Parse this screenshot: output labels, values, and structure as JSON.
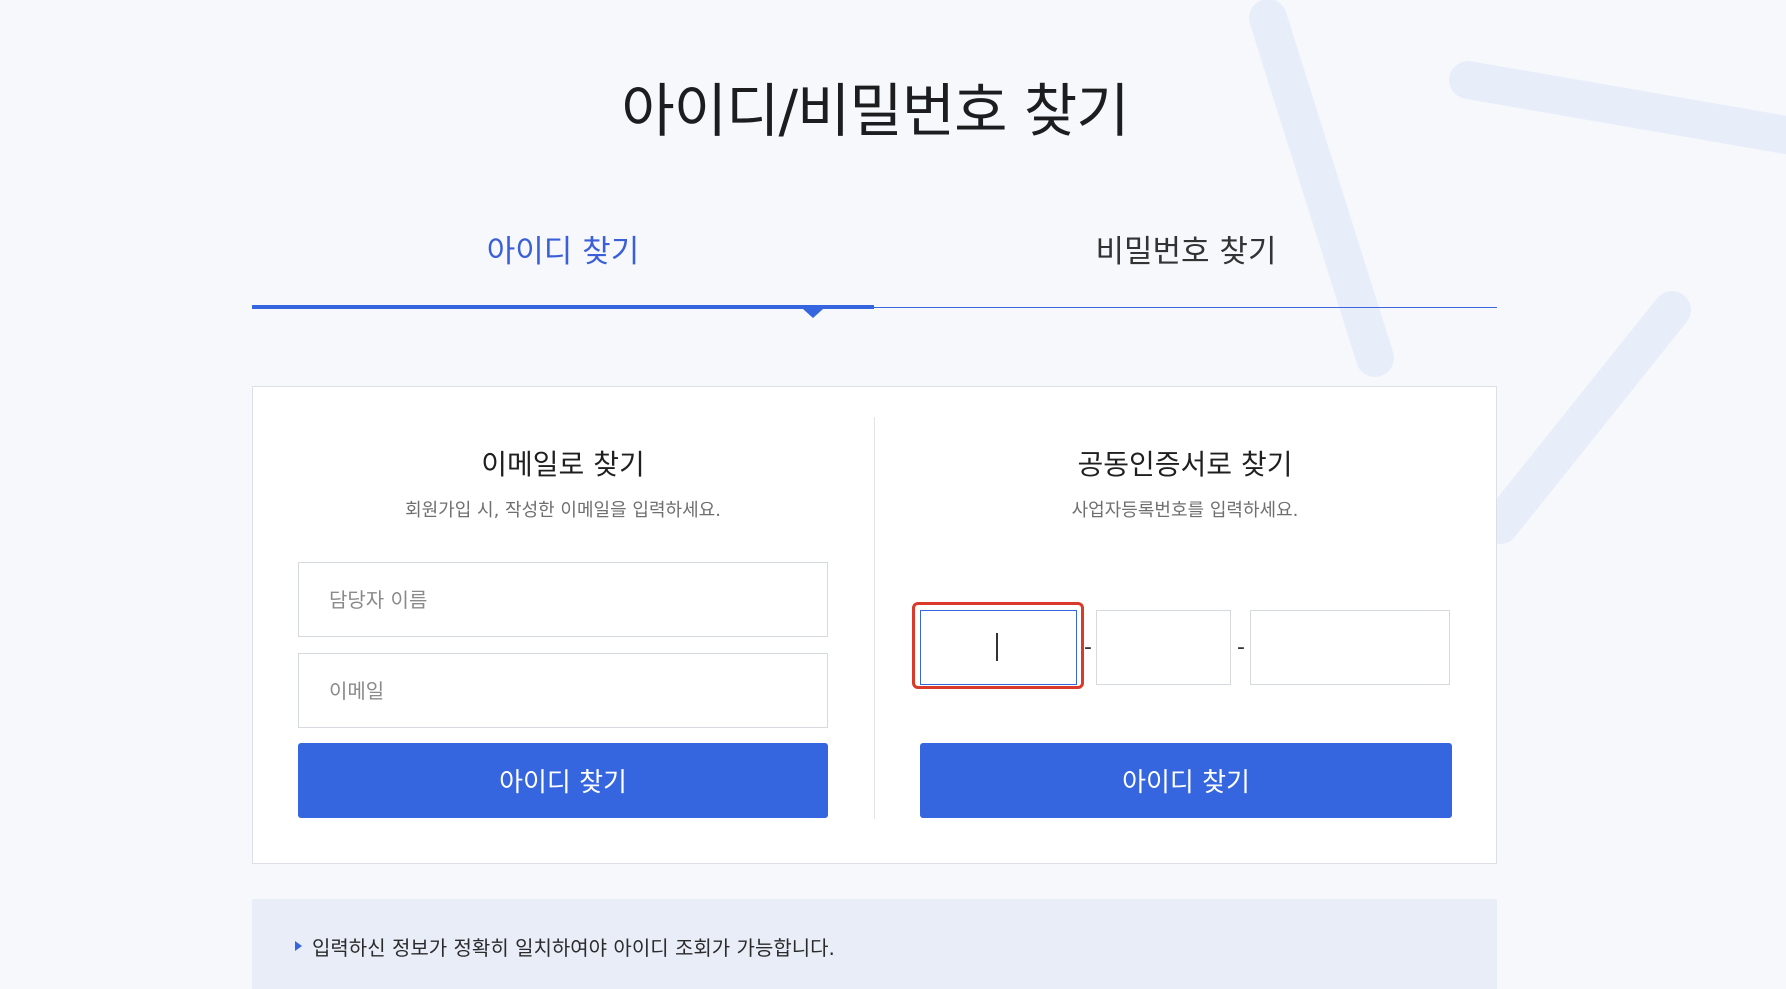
{
  "header": {
    "title": "아이디/비밀번호 찾기"
  },
  "tabs": [
    {
      "label": "아이디 찾기",
      "active": true
    },
    {
      "label": "비밀번호 찾기",
      "active": false
    }
  ],
  "email_panel": {
    "title": "이메일로 찾기",
    "description": "회원가입 시, 작성한 이메일을 입력하세요.",
    "name_placeholder": "담당자 이름",
    "name_value": "",
    "email_placeholder": "이메일",
    "email_value": "",
    "submit_label": "아이디 찾기"
  },
  "cert_panel": {
    "title": "공동인증서로 찾기",
    "description": "사업자등록번호를 입력하세요.",
    "biz_number_parts": [
      "",
      "",
      ""
    ],
    "separator": "-",
    "submit_label": "아이디 찾기"
  },
  "notice": {
    "text": "입력하신 정보가 정확히 일치하여야 아이디 조회가 가능합니다."
  },
  "colors": {
    "accent": "#3566e0",
    "active_tab_text": "#3a5fd6",
    "focus_highlight": "#d93a2b",
    "background": "#f6f8fc",
    "notice_background": "#e8edf8"
  }
}
